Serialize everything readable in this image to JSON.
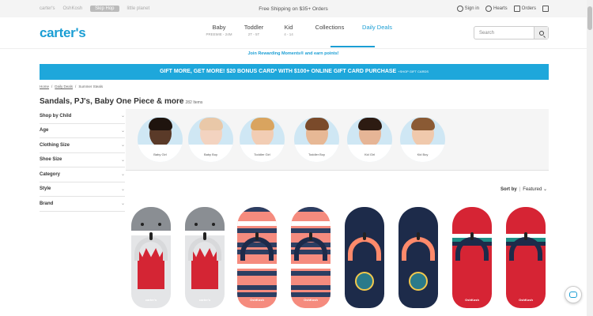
{
  "utility": {
    "brands": [
      "carter's",
      "OshKosh",
      "Skip Hop",
      "little planet"
    ],
    "shipping": "Free Shipping on $35+ Orders",
    "sign_in": "Sign in",
    "hearts": "Hearts",
    "orders": "Orders"
  },
  "header": {
    "logo": "carter's",
    "nav": [
      {
        "label": "Baby",
        "sub": "PREEMIE - 24M"
      },
      {
        "label": "Toddler",
        "sub": "2T - 5T"
      },
      {
        "label": "Kid",
        "sub": "4 - 14"
      },
      {
        "label": "Collections",
        "sub": ""
      },
      {
        "label": "Daily Deals",
        "sub": ""
      }
    ],
    "search_placeholder": "Search"
  },
  "rewards": "Join Rewarding Moments® and earn points!",
  "promo": {
    "text": "GIFT MORE, GET MORE! $20 BONUS CARD* WITH $100+ ONLINE GIFT CARD PURCHASE",
    "link": "+SHOP GIFT CARDS"
  },
  "breadcrumb": [
    "Home",
    "Daily Deals",
    "Summer Steals"
  ],
  "page": {
    "title": "Sandals, PJ's, Baby One Piece & more",
    "count": "282 Items"
  },
  "filters": [
    "Shop by Child",
    "Age",
    "Clothing Size",
    "Shoe Size",
    "Category",
    "Style",
    "Brand"
  ],
  "categories": [
    {
      "label": "Baby Girl",
      "skin": "#5a3a28",
      "hair": "#1f140e"
    },
    {
      "label": "Baby Boy",
      "skin": "#f3d3c0",
      "hair": "#e9c8a8"
    },
    {
      "label": "Toddler Girl",
      "skin": "#f2cdb4",
      "hair": "#d9a45f"
    },
    {
      "label": "Toddler Boy",
      "skin": "#e7b895",
      "hair": "#7a4a2a"
    },
    {
      "label": "Kid Girl",
      "skin": "#e6b596",
      "hair": "#2d1b12"
    },
    {
      "label": "Kid Boy",
      "skin": "#f0c9ac",
      "hair": "#8a5a34"
    }
  ],
  "sort": {
    "label": "Sort by",
    "value": "Featured"
  },
  "products": [
    {
      "style": "shark",
      "color": "#9aa0a6",
      "brand": "carter's"
    },
    {
      "style": "shark",
      "color": "#9aa0a6",
      "brand": "carter's"
    },
    {
      "style": "stripe",
      "color": "#f58b7e",
      "brand": "OshKosh"
    },
    {
      "style": "stripe",
      "color": "#f58b7e",
      "brand": "OshKosh"
    },
    {
      "style": "navy",
      "color": "#1d2b4a",
      "brand": ""
    },
    {
      "style": "navy",
      "color": "#1d2b4a",
      "brand": ""
    },
    {
      "style": "red",
      "color": "#d62434",
      "brand": "OshKosh"
    },
    {
      "style": "red",
      "color": "#d62434",
      "brand": "OshKosh"
    }
  ],
  "colors": {
    "brand_blue": "#1b9ed4",
    "promo_blue": "#1ea7db"
  }
}
